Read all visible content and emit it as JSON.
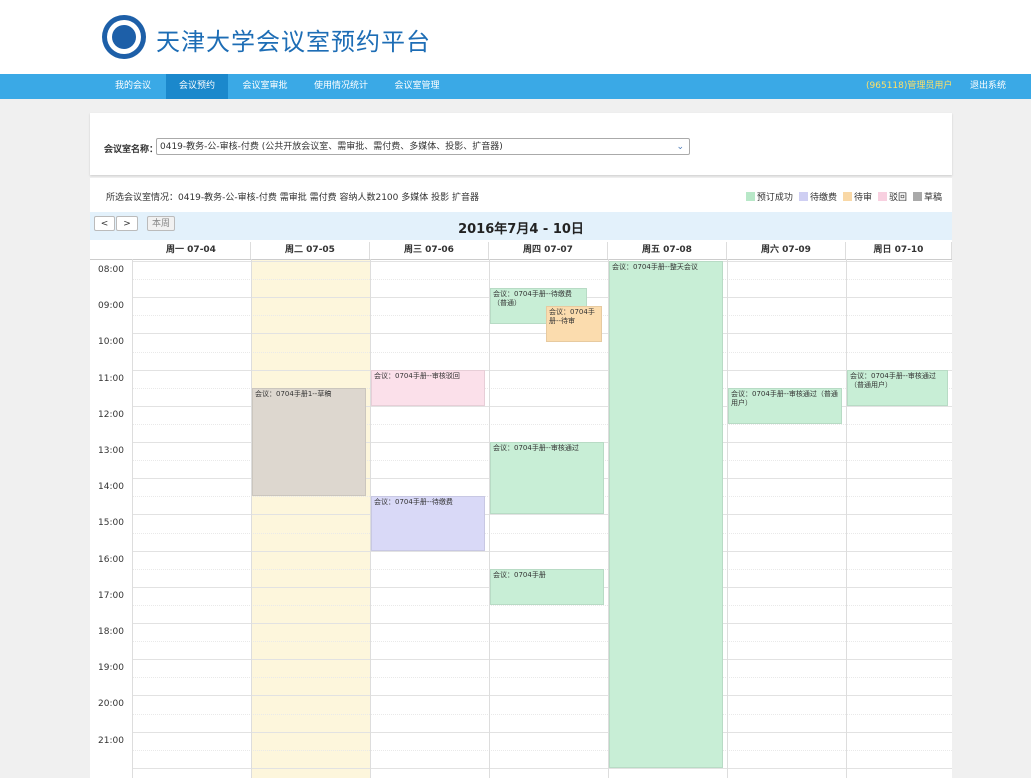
{
  "header": {
    "title": "天津大学会议室预约平台"
  },
  "nav": {
    "items": [
      "我的会议",
      "会议预约",
      "会议室审批",
      "使用情况统计",
      "会议室管理"
    ],
    "user": "(965118)管理员用户",
    "logout": "退出系统"
  },
  "room": {
    "label": "会议室名称：",
    "selected": "0419-教务-公-审核-付费 (公共开放会议室、需审批、需付费、多媒体、投影、扩音器)"
  },
  "info": "所选会议室情况：0419-教务-公-审核-付费 需审批 需付费 容纳人数2100 多媒体 投影 扩音器",
  "legend": [
    {
      "label": "预订成功",
      "color": "#b8e8c8"
    },
    {
      "label": "待缴费",
      "color": "#cfcff3"
    },
    {
      "label": "待审",
      "color": "#f9d8a6"
    },
    {
      "label": "驳回",
      "color": "#f8d0e0"
    },
    {
      "label": "草稿",
      "color": "#a9a9a9"
    }
  ],
  "toolbar": {
    "prev": "<",
    "next": ">",
    "this_week": "本周"
  },
  "week_title": "2016年7月4 - 10日",
  "days": [
    "周一 07-04",
    "周二 07-05",
    "周三 07-06",
    "周四 07-07",
    "周五 07-08",
    "周六 07-09",
    "周日 07-10"
  ],
  "times": [
    "08:00",
    "09:00",
    "10:00",
    "11:00",
    "12:00",
    "13:00",
    "14:00",
    "15:00",
    "16:00",
    "17:00",
    "18:00",
    "19:00",
    "20:00",
    "21:00"
  ],
  "events": [
    {
      "day": 4,
      "start": "08:00",
      "end": "22:00",
      "text": "会议：0704手册--整天会议",
      "color": "#c8eed6"
    },
    {
      "day": 3,
      "start": "08:45",
      "end": "09:45",
      "text": "会议：0704手册--待缴费（普通）",
      "color": "#c8eed6"
    },
    {
      "day": 3,
      "start": "09:15",
      "end": "10:15",
      "text": "会议：0704手册--待审",
      "color": "#fbdcae"
    },
    {
      "day": 2,
      "start": "11:00",
      "end": "12:00",
      "text": "会议：0704手册--审核驳回",
      "color": "#fbe0ea"
    },
    {
      "day": 1,
      "start": "11:30",
      "end": "14:30",
      "text": "会议：0704手册1--草稿",
      "color": "#ddd7cf"
    },
    {
      "day": 5,
      "start": "11:30",
      "end": "12:30",
      "text": "会议：0704手册--审核通过（普通用户）",
      "color": "#c8eed6"
    },
    {
      "day": 6,
      "start": "11:00",
      "end": "12:00",
      "text": "会议：0704手册--审核通过（普通用户）",
      "color": "#c8eed6"
    },
    {
      "day": 3,
      "start": "13:00",
      "end": "15:00",
      "text": "会议：0704手册--审核通过",
      "color": "#c8eed6"
    },
    {
      "day": 2,
      "start": "14:30",
      "end": "16:00",
      "text": "会议：0704手册--待缴费",
      "color": "#d9d9f7"
    },
    {
      "day": 3,
      "start": "16:30",
      "end": "17:30",
      "text": "会议：0704手册",
      "color": "#c8eed6"
    }
  ],
  "highlight_day": 1,
  "highlight_color": "#fdf6dc"
}
